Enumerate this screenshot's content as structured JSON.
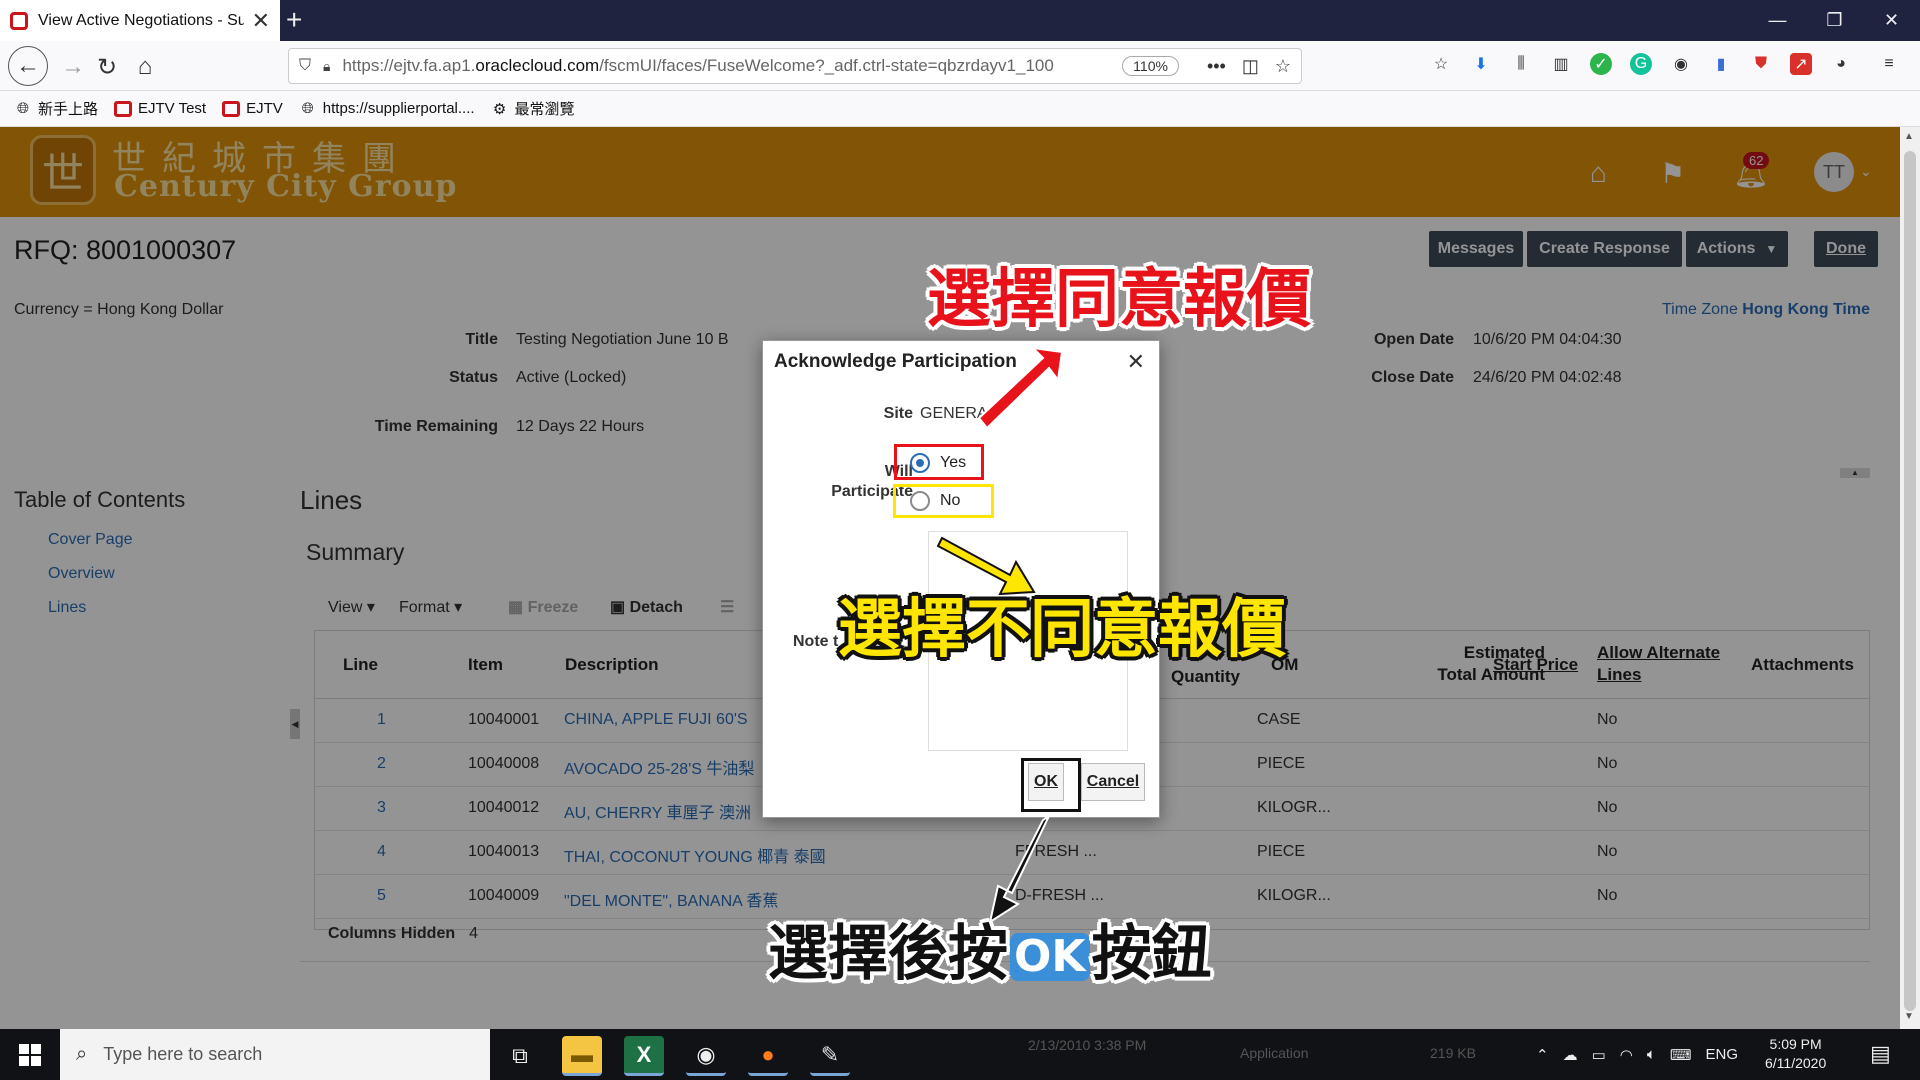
{
  "browser": {
    "tab_title": "View Active Negotiations - Sup",
    "url_prefix": "https://ejtv.fa.ap1.",
    "url_domain": "oraclecloud.com",
    "url_suffix": "/fscmUI/faces/FuseWelcome?_adf.ctrl-state=qbzrdayv1_100",
    "zoom": "110%",
    "bookmarks": [
      "新手上路",
      "EJTV Test",
      "EJTV",
      "https://supplierportal....",
      "最常瀏覽"
    ]
  },
  "header": {
    "logo_cn": "世紀城市集團",
    "logo_en": "Century City Group",
    "notification_count": "62",
    "avatar_initials": "TT"
  },
  "page": {
    "rfq_title": "RFQ: 8001000307",
    "buttons": {
      "messages": "Messages",
      "create_response": "Create Response",
      "actions": "Actions",
      "done": "Done"
    },
    "currency": "Currency = Hong Kong Dollar",
    "timezone_label": "Time Zone",
    "timezone_value": "Hong Kong Time",
    "fields": {
      "title_label": "Title",
      "title_value": "Testing Negotiation June 10 B",
      "status_label": "Status",
      "status_value": "Active (Locked)",
      "time_remaining_label": "Time Remaining",
      "time_remaining_value": "12 Days 22 Hours",
      "open_date_label": "Open Date",
      "open_date_value": "10/6/20 PM 04:04:30",
      "close_date_label": "Close Date",
      "close_date_value": "24/6/20 PM 04:02:48"
    },
    "toc": {
      "title": "Table of Contents",
      "items": [
        "Cover Page",
        "Overview",
        "Lines"
      ]
    },
    "lines_title": "Lines",
    "summary_title": "Summary",
    "toolbar": {
      "view": "View",
      "format": "Format",
      "freeze": "Freeze",
      "detach": "Detach"
    },
    "grid": {
      "columns": {
        "line": "Line",
        "item": "Item",
        "description": "Description",
        "quantity": "Quantity",
        "uom": "OM",
        "estimated_total_1": "Estimated",
        "estimated_total_2": "Total Amount",
        "start_price": "Start Price",
        "allow_alt_1": "Allow Alternate",
        "allow_alt_2": "Lines",
        "attachments": "Attachments"
      },
      "rows": [
        {
          "line": "1",
          "item": "10040001",
          "description": "CHINA, APPLE FUJI 60'S",
          "category": "",
          "uom": "CASE",
          "alt": "No"
        },
        {
          "line": "2",
          "item": "10040008",
          "description": "AVOCADO 25-28'S 牛油梨",
          "category": "",
          "uom": "PIECE",
          "alt": "No"
        },
        {
          "line": "3",
          "item": "10040012",
          "description": "AU, CHERRY 車厘子 澳洲",
          "category": "",
          "uom": "KILOGR...",
          "alt": "No"
        },
        {
          "line": "4",
          "item": "10040013",
          "description": "THAI, COCONUT YOUNG 椰青 泰國",
          "category": "FFRESH ...",
          "uom": "PIECE",
          "alt": "No"
        },
        {
          "line": "5",
          "item": "10040009",
          "description": "\"DEL MONTE\", BANANA 香蕉",
          "category": "D-FRESH ...",
          "uom": "KILOGR...",
          "alt": "No"
        }
      ],
      "columns_hidden_label": "Columns Hidden",
      "columns_hidden_value": "4"
    }
  },
  "dialog": {
    "title": "Acknowledge Participation",
    "site_label": "Site",
    "site_value": "GENERAL",
    "will_label": "Will",
    "participate_label": "Participate",
    "yes": "Yes",
    "no": "No",
    "note_label": "Note t",
    "ok": "OK",
    "cancel": "Cancel",
    "selected": "Yes"
  },
  "annotations": {
    "agree": "選擇同意報價",
    "disagree": "選擇不同意報價",
    "after_prefix": "選擇後按",
    "after_ok": "OK",
    "after_suffix": "按鈕",
    "colors": {
      "red": "#e8131a",
      "yellow": "#ffe600",
      "black": "#111111"
    }
  },
  "taskbar": {
    "search_placeholder": "Type here to search",
    "lang": "ENG",
    "time": "5:09 PM",
    "date": "6/11/2020"
  }
}
